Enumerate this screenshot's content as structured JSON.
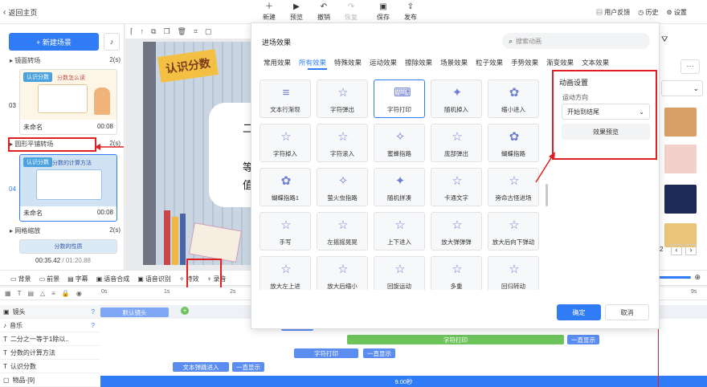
{
  "topbar": {
    "back_label": "返回主页",
    "new_label": "新建",
    "preview_label": "预览",
    "undo_label": "撤销",
    "redo_label": "恢复",
    "save_label": "保存",
    "publish_label": "发布",
    "feedback_label": "用户反馈",
    "history_label": "历史",
    "settings_label": "设置"
  },
  "left": {
    "new_scene_label": "+ 新建场景",
    "scenes": [
      {
        "name": "镜面转场",
        "duration": "2(s)"
      },
      {
        "name": "圆形平铺转场",
        "duration": "2(s)"
      },
      {
        "name": "网格缩放",
        "duration": "2(s)"
      }
    ],
    "cards": [
      {
        "index": "03",
        "title": "未命名",
        "time": "00:08",
        "tag": "认识分数",
        "heading": "分数怎么读"
      },
      {
        "index": "04",
        "title": "未命名",
        "time": "00:08",
        "tag": "认识分数",
        "heading": "分数的计算方法"
      }
    ],
    "bottom_card_heading": "分数的性质",
    "time_current": "00:35.42",
    "time_total": "/ 01:20.88"
  },
  "canvas": {
    "banner": "认识分数",
    "texts": [
      "二",
      "等",
      "值"
    ]
  },
  "toolbar": {
    "items": [
      "背景",
      "前景",
      "字幕",
      "语音合成",
      "语音识别",
      "特效",
      "录音"
    ]
  },
  "timeline": {
    "ruler": [
      "0s",
      "1s",
      "2s",
      "9s"
    ],
    "tracks": [
      {
        "label": "镜头",
        "clips": [
          {
            "text": "默认镜头",
            "color": "#7da7f5"
          }
        ]
      },
      {
        "label": "音乐",
        "clips": []
      },
      {
        "label": "二分之一等于1除以..",
        "clips": [
          {
            "text": "字符打印",
            "color": "#6dc45b"
          },
          {
            "text": "一直显示",
            "color": "#5b8df0"
          }
        ]
      },
      {
        "label": "分数的计算方法",
        "clips": [
          {
            "text": "字符打印",
            "color": "#5b8df0"
          },
          {
            "text": "一直显示",
            "color": "#5b8df0"
          }
        ]
      },
      {
        "label": "认识分数",
        "clips": [
          {
            "text": "文本弹跳进入",
            "color": "#5b8df0"
          },
          {
            "text": "一直显示",
            "color": "#5b8df0"
          }
        ]
      },
      {
        "label": "物品-[9]",
        "clips": [
          {
            "text": "9.00秒",
            "color": "#2f7cf6"
          }
        ]
      }
    ]
  },
  "modal": {
    "title": "进场效果",
    "search_placeholder": "搜索动画",
    "tabs": [
      "常用效果",
      "所有效果",
      "特殊效果",
      "运动效果",
      "擦除效果",
      "场景效果",
      "粒子效果",
      "手势效果",
      "渐变效果",
      "文本效果"
    ],
    "active_tab": "所有效果",
    "effects": [
      "文本行渐现",
      "字符弹出",
      "字符打印",
      "随机掉入",
      "缩小进入",
      "字符掉入",
      "字符滚入",
      "蜜蜂指路",
      "庞部弹出",
      "蝴蝶指路",
      "蝴蝶指路1",
      "萤火虫指路",
      "随机拼凑",
      "卡通文字",
      "旁命古怪进场",
      "手写",
      "左摇摇晃晃",
      "上下进入",
      "放大弹弹弹",
      "放大后向下弹动",
      "放大左上进",
      "放大后缩小",
      "回旋运动",
      "多重",
      "回归转动"
    ],
    "selected_effect": "字符打印",
    "settings_title": "动画设置",
    "direction_label": "运动方向",
    "direction_value": "开始到结尾",
    "preview_button": "效果预览",
    "ok_button": "确定",
    "cancel_button": "取消"
  },
  "right_panel": {
    "page_number": "2"
  },
  "colors": {
    "accent": "#2f7cf6",
    "highlight": "#e02020"
  }
}
